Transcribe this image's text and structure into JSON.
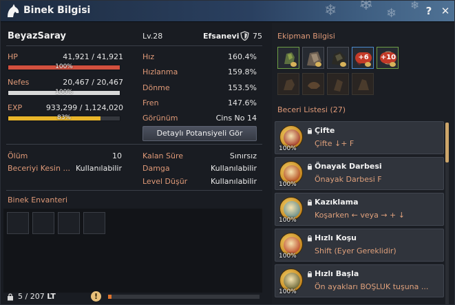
{
  "window": {
    "title": "Binek Bilgisi",
    "help_label": "?",
    "close_label": "✕"
  },
  "horse": {
    "name": "BeyazSaray",
    "level": "Lv.28",
    "grade": "Efsanevi",
    "grade_value": "75"
  },
  "stats": {
    "hp": {
      "label": "HP",
      "current": "41,921",
      "max": "41,921",
      "percent": "100%",
      "fraction": 1.0,
      "color": "#d2503e"
    },
    "nefes": {
      "label": "Nefes",
      "current": "20,467",
      "max": "20,467",
      "percent": "100%",
      "fraction": 1.0,
      "color": "#d8d8d8"
    },
    "exp": {
      "label": "EXP",
      "current": "933,299",
      "max": "1,124,020",
      "percent": "83%",
      "fraction": 0.83,
      "color": "#e8b52a"
    }
  },
  "attributes": [
    {
      "label": "Hız",
      "value": "160.4%"
    },
    {
      "label": "Hızlanma",
      "value": "159.8%"
    },
    {
      "label": "Dönme",
      "value": "153.5%"
    },
    {
      "label": "Fren",
      "value": "147.6%"
    },
    {
      "label": "Görünüm",
      "value": "Cins No 14"
    }
  ],
  "potential_button": "Detaylı Potansiyeli Gör",
  "status": {
    "olum_label": "Ölüm",
    "olum_value": "10",
    "beceri_label": "Beceriyi Kesin ...",
    "beceri_value": "Kullanılabilir",
    "kalan_label": "Kalan Süre",
    "kalan_value": "Sınırsız",
    "damga_label": "Damga",
    "damga_value": "Kullanılabilir",
    "level_label": "Level Düşür",
    "level_value": "Kullanılabilir"
  },
  "inventory": {
    "title": "Binek Envanteri",
    "weight": "5",
    "weight_max": "207",
    "unit": "LT",
    "warning": "!",
    "weight_fraction": 0.024
  },
  "equipment": {
    "title": "Ekipman Bilgisi",
    "badges": [
      "+6",
      "+10"
    ]
  },
  "skills": {
    "title": "Beceri Listesi (27)",
    "items": [
      {
        "name": "Çifte",
        "desc": "Çifte ↓+ F",
        "percent": "100%",
        "color": "#a53d2a"
      },
      {
        "name": "Önayak Darbesi",
        "desc": "Önayak Darbesi F",
        "percent": "100%",
        "color": "#b5501f"
      },
      {
        "name": "Kazıklama",
        "desc": "Koşarken ← veya → + ↓",
        "percent": "100%",
        "color": "#6a8f8a"
      },
      {
        "name": "Hızlı Koşu",
        "desc": "Shift (Eyer Gereklidir)",
        "percent": "100%",
        "color": "#c0522e"
      },
      {
        "name": "Hızlı Başla",
        "desc": "Ön ayakları BOŞLUK tuşuna ...",
        "percent": "100%",
        "color": "#6f6a3a"
      }
    ]
  },
  "colors": {
    "accent": "#e09a78",
    "title_bar": "#2a4060",
    "gold": "#cda66a"
  }
}
